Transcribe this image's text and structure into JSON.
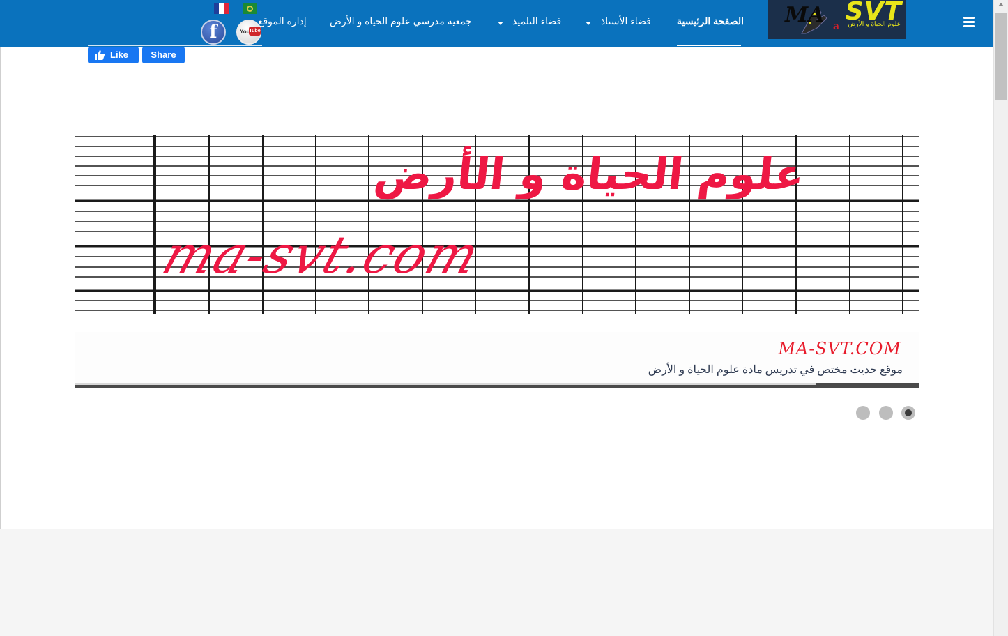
{
  "header": {
    "logo": {
      "brand": "SVT",
      "ma": "MA",
      "subtitle": "علوم الحياة و الأرض",
      "a_letter": "a"
    },
    "nav": {
      "home": "الصفحة الرئيسية",
      "teacher_space": "فضاء الأستاذ",
      "student_space": "فضاء التلميذ",
      "association": "جمعية مدرسي علوم الحياة و الأرض",
      "site_admin": "إدارة الموقع"
    },
    "social": {
      "facebook_glyph": "f",
      "youtube_you": "You",
      "youtube_tube": "Tube"
    },
    "facebook_buttons": {
      "like": "Like",
      "share": "Share"
    }
  },
  "slider": {
    "banner_arabic": "علوم الحياة و الأرض",
    "banner_latin": "ma-svt.com",
    "caption_title": "MA-SVT.COM",
    "caption_text": "موقع حديث مختص في تدريس مادة علوم الحياة و الأرض",
    "progress_fraction": 0.878,
    "slide_count": 3,
    "active_slide": 3
  },
  "colors": {
    "navbar": "#0a72bd",
    "banner_text": "#ee1844",
    "caption_title": "#e81c2c",
    "facebook_blue": "#1877f2"
  },
  "icons": {
    "menu": "hamburger-icon",
    "flag_fr": "flag-france-icon",
    "flag_ar": "flag-arabic-icon",
    "thumb": "thumbs-up-icon"
  }
}
